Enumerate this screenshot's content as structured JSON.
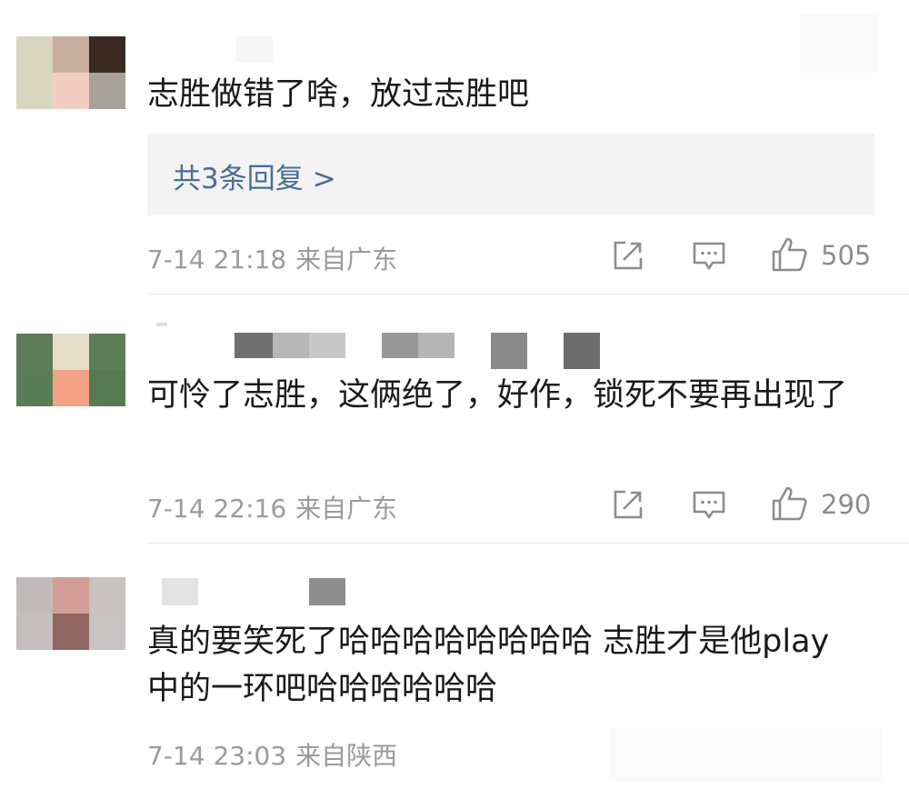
{
  "comments": [
    {
      "text": "志胜做错了啥，放过志胜吧",
      "reply_link": "共3条回复 >",
      "date": "7-14 21:18",
      "location": "来自广东",
      "likes": "505",
      "avatar_colors": [
        "#d9d6bf",
        "#c8aea0",
        "#3a2a22",
        "#d9d6bf",
        "#f2cec2",
        "#a6a19a"
      ]
    },
    {
      "text": "可怜了志胜，这俩绝了，好作，锁死不要再出现了",
      "date": "7-14 22:16",
      "location": "来自广东",
      "likes": "290",
      "avatar_colors": [
        "#5f7d58",
        "#e5ddc8",
        "#5d7e58",
        "#597d56",
        "#f2a184",
        "#567a52"
      ]
    },
    {
      "text": "真的要笑死了哈哈哈哈哈哈哈哈 志胜才是他play 中的一环吧哈哈哈哈哈哈",
      "date": "7-14 23:03",
      "location": "来自陕西",
      "avatar_colors": [
        "#c3b9bb",
        "#d49e96",
        "#c8c2c1",
        "#c5bdbe",
        "#8f6660",
        "#c9c3c3"
      ]
    }
  ],
  "icons": {
    "share": "share-icon",
    "comment": "comment-icon",
    "like": "like-icon"
  }
}
